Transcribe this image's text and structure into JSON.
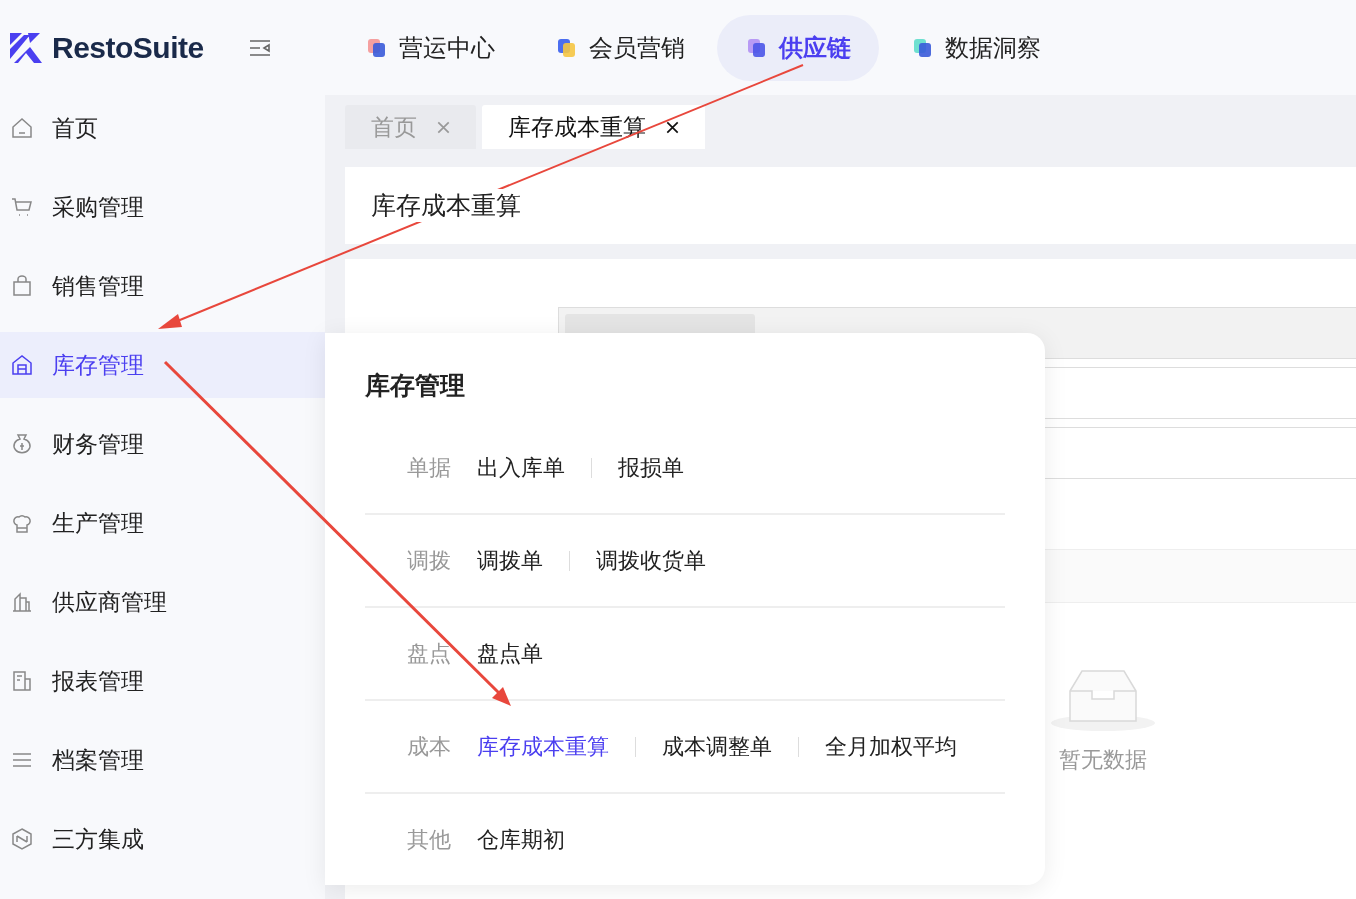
{
  "brand": {
    "name": "RestoSuite"
  },
  "top_nav": [
    {
      "label": "营运中心",
      "selected": false
    },
    {
      "label": "会员营销",
      "selected": false
    },
    {
      "label": "供应链",
      "selected": true
    },
    {
      "label": "数据洞察",
      "selected": false
    }
  ],
  "sidebar": {
    "items": [
      {
        "label": "首页",
        "selected": false
      },
      {
        "label": "采购管理",
        "selected": false
      },
      {
        "label": "销售管理",
        "selected": false
      },
      {
        "label": "库存管理",
        "selected": true
      },
      {
        "label": "财务管理",
        "selected": false
      },
      {
        "label": "生产管理",
        "selected": false
      },
      {
        "label": "供应商管理",
        "selected": false
      },
      {
        "label": "报表管理",
        "selected": false
      },
      {
        "label": "档案管理",
        "selected": false
      },
      {
        "label": "三方集成",
        "selected": false
      }
    ]
  },
  "tabs": [
    {
      "label": "首页",
      "selected": false
    },
    {
      "label": "库存成本重算",
      "selected": true
    }
  ],
  "page": {
    "title": "库存成本重算",
    "empty_text": "暂无数据"
  },
  "flyout": {
    "title": "库存管理",
    "groups": [
      {
        "category": "单据",
        "links": [
          {
            "label": "出入库单",
            "selected": false
          },
          {
            "label": "报损单",
            "selected": false
          }
        ]
      },
      {
        "category": "调拨",
        "links": [
          {
            "label": "调拨单",
            "selected": false
          },
          {
            "label": "调拨收货单",
            "selected": false
          }
        ]
      },
      {
        "category": "盘点",
        "links": [
          {
            "label": "盘点单",
            "selected": false
          }
        ]
      },
      {
        "category": "成本",
        "links": [
          {
            "label": "库存成本重算",
            "selected": true
          },
          {
            "label": "成本调整单",
            "selected": false
          },
          {
            "label": "全月加权平均",
            "selected": false
          }
        ]
      },
      {
        "category": "其他",
        "links": [
          {
            "label": "仓库期初",
            "selected": false
          }
        ]
      }
    ]
  }
}
